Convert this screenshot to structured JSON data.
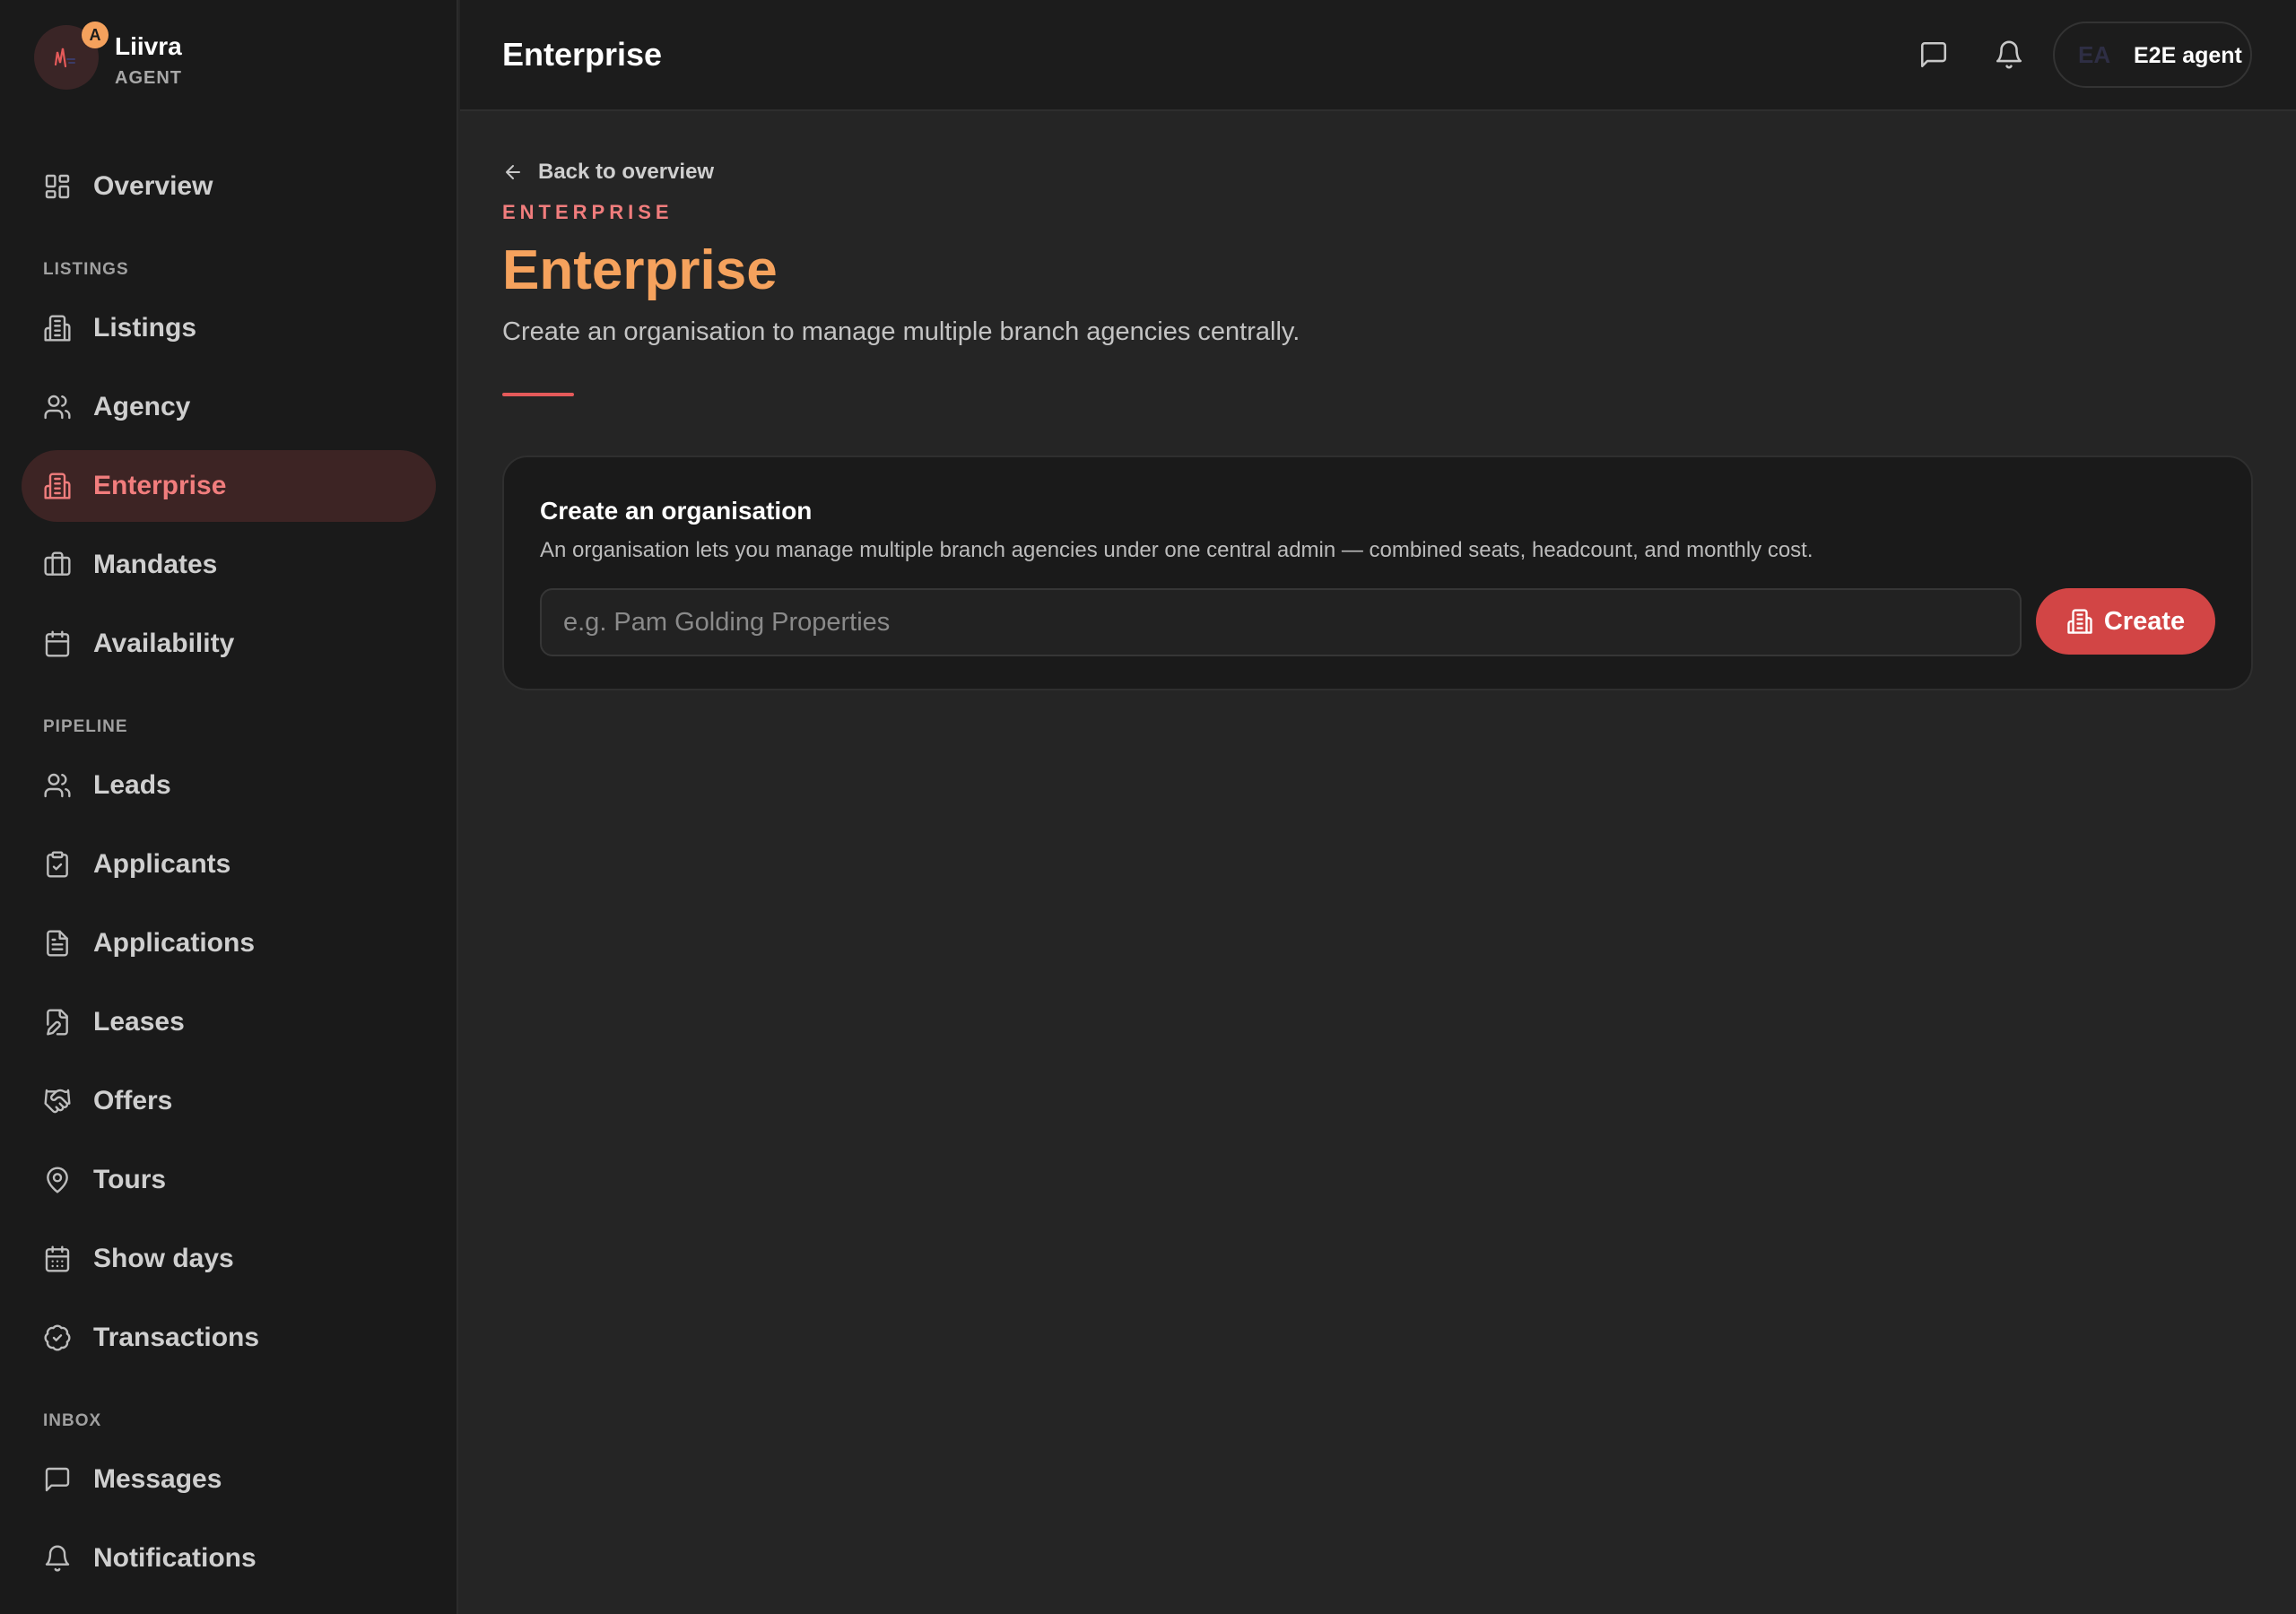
{
  "brand": {
    "name": "Liivra",
    "sub": "AGENT",
    "badge": "A"
  },
  "sidebar": {
    "items": [
      {
        "label": "Overview"
      },
      {
        "section": "LISTINGS"
      },
      {
        "label": "Listings"
      },
      {
        "label": "Agency"
      },
      {
        "label": "Enterprise",
        "active": true
      },
      {
        "label": "Mandates"
      },
      {
        "label": "Availability"
      },
      {
        "section": "PIPELINE"
      },
      {
        "label": "Leads"
      },
      {
        "label": "Applicants"
      },
      {
        "label": "Applications"
      },
      {
        "label": "Leases"
      },
      {
        "label": "Offers"
      },
      {
        "label": "Tours"
      },
      {
        "label": "Show days"
      },
      {
        "label": "Transactions"
      },
      {
        "section": "INBOX"
      },
      {
        "label": "Messages"
      },
      {
        "label": "Notifications"
      }
    ]
  },
  "header": {
    "title": "Enterprise",
    "user": {
      "initials": "EA",
      "name": "E2E agent"
    }
  },
  "main": {
    "back_label": "Back to overview",
    "eyebrow": "ENTERPRISE",
    "title": "Enterprise",
    "subtitle": "Create an organisation to manage multiple branch agencies centrally.",
    "card": {
      "title": "Create an organisation",
      "description": "An organisation lets you manage multiple branch agencies under one central admin — combined seats, headcount, and monthly cost.",
      "input_placeholder": "e.g. Pam Golding Properties",
      "input_value": "",
      "button_label": "Create"
    }
  },
  "colors": {
    "accent": "#d24545",
    "active_text": "#f17d7d",
    "title_orange": "#f5a25d",
    "background": "#252525",
    "sidebar_bg": "#1a1a1a"
  }
}
